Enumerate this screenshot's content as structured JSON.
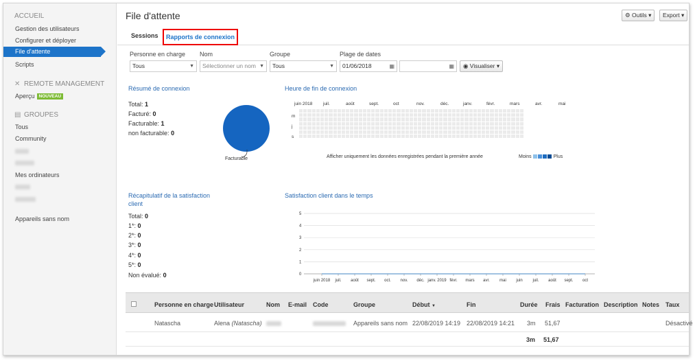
{
  "sidebar": {
    "accueil_header": "ACCUEIL",
    "accueil_items": [
      "Gestion des utilisateurs",
      "Configurer et déployer",
      "File d'attente",
      "Scripts"
    ],
    "remote_header": "REMOTE MANAGEMENT",
    "apercu_label": "Aperçu",
    "apercu_badge": "NOUVEAU",
    "groupes_header": "GROUPES",
    "group_tous": "Tous",
    "group_community": "Community",
    "group_mes_ordinateurs": "Mes ordinateurs",
    "group_appareils_sans_nom": "Appareils sans nom"
  },
  "header": {
    "title": "File d'attente",
    "outils_label": "Outils",
    "export_label": "Export"
  },
  "tabs": {
    "sessions": "Sessions",
    "rapports": "Rapports de connexion"
  },
  "filters": {
    "personne_label": "Personne en charge",
    "personne_value": "Tous",
    "nom_label": "Nom",
    "nom_placeholder": "Sélectionner un nom",
    "groupe_label": "Groupe",
    "groupe_value": "Tous",
    "dates_label": "Plage de dates",
    "date_start": "01/06/2018",
    "date_end": "",
    "visualiser_label": "Visualiser"
  },
  "resume": {
    "title": "Résumé de connexion",
    "total_label": "Total:",
    "total_value": "1",
    "facture_label": "Facturé:",
    "facture_value": "0",
    "facturable_label": "Facturable:",
    "facturable_value": "1",
    "non_facturable_label": "non facturable:",
    "non_facturable_value": "0",
    "pie_label": "Facturable"
  },
  "heatmap": {
    "title": "Heure de fin de connexion",
    "months": [
      "juin 2018",
      "juil.",
      "août",
      "sept.",
      "oct",
      "nov.",
      "déc.",
      "janv.",
      "févr.",
      "mars",
      "avr.",
      "mai"
    ],
    "rows": [
      "m",
      "j",
      "s"
    ],
    "note": "Afficher uniquement les données enregistrées pendant la première année",
    "legend_less": "Moins",
    "legend_more": "Plus",
    "legend_colors": [
      "#8ec1ea",
      "#4a90d9",
      "#1d6cc0",
      "#0d4d94"
    ]
  },
  "satisfaction": {
    "title": "Récapitulatif de la satisfaction client",
    "total_label": "Total:",
    "total_value": "0",
    "s1_label": "1*:",
    "s1_value": "0",
    "s2_label": "2*:",
    "s2_value": "0",
    "s3_label": "3*:",
    "s3_value": "0",
    "s4_label": "4*:",
    "s4_value": "0",
    "s5_label": "5*:",
    "s5_value": "0",
    "non_evalue_label": "Non évalué:",
    "non_evalue_value": "0"
  },
  "chart_data": {
    "type": "line",
    "title": "Satisfaction client dans le temps",
    "categories": [
      "juin 2018",
      "juil.",
      "août",
      "sept.",
      "oct.",
      "nov.",
      "déc.",
      "janv. 2019",
      "févr.",
      "mars",
      "avr.",
      "mai",
      "juin",
      "juil.",
      "août",
      "sept.",
      "oct"
    ],
    "series": [
      {
        "values": [
          0,
          0,
          0,
          0,
          0,
          0,
          0,
          0,
          0,
          0,
          0,
          0,
          0,
          0,
          0,
          0,
          0
        ]
      }
    ],
    "ylim": [
      0,
      5
    ],
    "yticks": [
      0,
      1,
      2,
      3,
      4,
      5
    ],
    "grid": true
  },
  "table": {
    "headers": [
      "Personne en charge",
      "Utilisateur",
      "Nom",
      "E-mail",
      "Code",
      "Groupe",
      "Début",
      "Fin",
      "Durée",
      "Frais",
      "Facturation",
      "Description",
      "Notes",
      "Taux"
    ],
    "sort_indicator": "▼",
    "row": {
      "personne": "Natascha",
      "utilisateur": "Alena",
      "utilisateur_extra": "(Natascha)",
      "groupe": "Appareils sans nom",
      "debut": "22/08/2019 14:19",
      "fin": "22/08/2019 14:21",
      "duree": "3m",
      "frais": "51,67",
      "taux": "Désactivé"
    },
    "footer": {
      "duree": "3m",
      "frais": "51,67"
    }
  }
}
